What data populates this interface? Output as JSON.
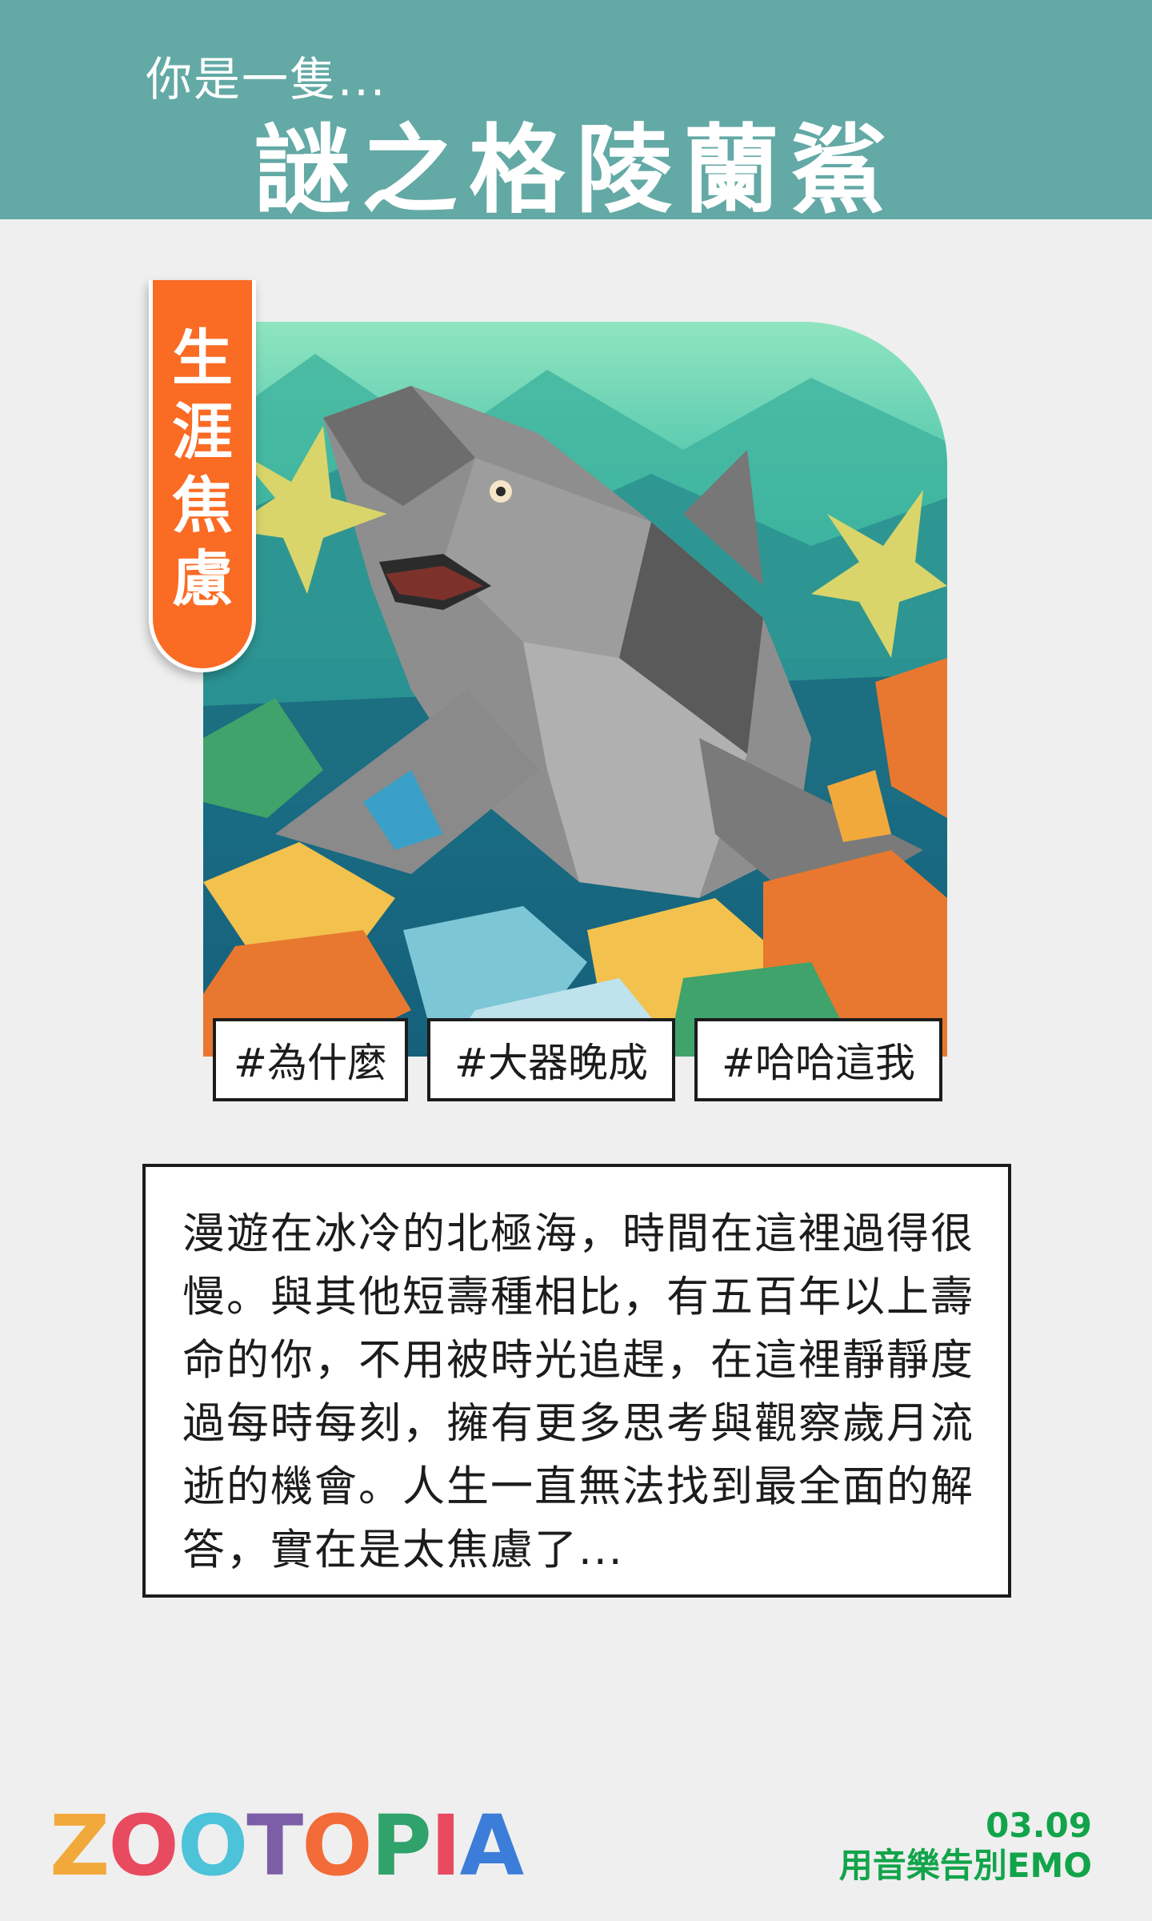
{
  "header": {
    "subtitle": "你是一隻...",
    "title": "謎之格陵蘭鯊"
  },
  "ribbon": {
    "chars": [
      "生",
      "涯",
      "焦",
      "慮"
    ]
  },
  "tags": [
    "#為什麼",
    "#大器晚成",
    "#哈哈這我"
  ],
  "description": "漫遊在冰冷的北極海，時間在這裡過得很慢。與其他短壽種相比，有五百年以上壽命的你，不用被時光追趕，在這裡靜靜度過每時每刻，擁有更多思考與觀察歲月流逝的機會。人生一直無法找到最全面的解答，實在是太焦慮了...",
  "logo": {
    "letters": [
      "Z",
      "O",
      "O",
      "T",
      "O",
      "P",
      "I",
      "A"
    ],
    "colors": [
      "#f2a93b",
      "#e84a5f",
      "#4cc3d9",
      "#7b5ea7",
      "#f26b38",
      "#2fa36b",
      "#e84a5f",
      "#3b7dd8"
    ]
  },
  "event": {
    "date": "03.09",
    "name": "用音樂告別EMO"
  },
  "colors": {
    "header_bg": "#63a9a5",
    "ribbon": "#fa6b24",
    "event_text": "#12a44a"
  }
}
